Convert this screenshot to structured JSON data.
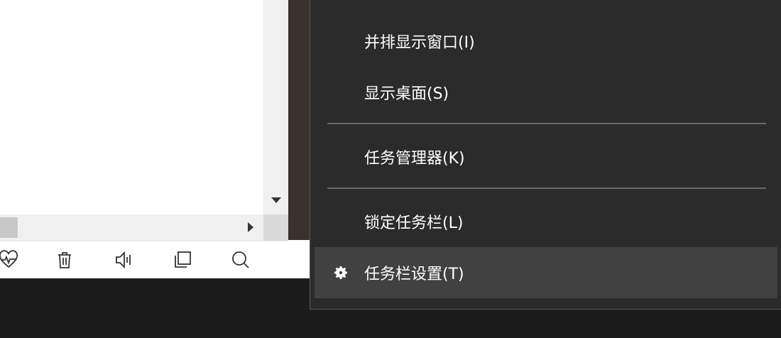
{
  "context_menu": {
    "items": [
      {
        "label": "并排显示窗口(I)"
      },
      {
        "label": "显示桌面(S)"
      },
      {
        "label": "任务管理器(K)"
      },
      {
        "label": "锁定任务栏(L)"
      },
      {
        "label": "任务栏设置(T)",
        "icon": "gear-icon",
        "highlighted": true
      }
    ]
  },
  "toolbar": {
    "icons": [
      "heart-rate-icon",
      "trash-icon",
      "speaker-icon",
      "copy-icon",
      "search-icon"
    ]
  },
  "colors": {
    "menu_bg": "#2b2b2b",
    "menu_hover": "#414141",
    "menu_text": "#ffffff",
    "taskbar_bg": "#1c1c1c"
  }
}
